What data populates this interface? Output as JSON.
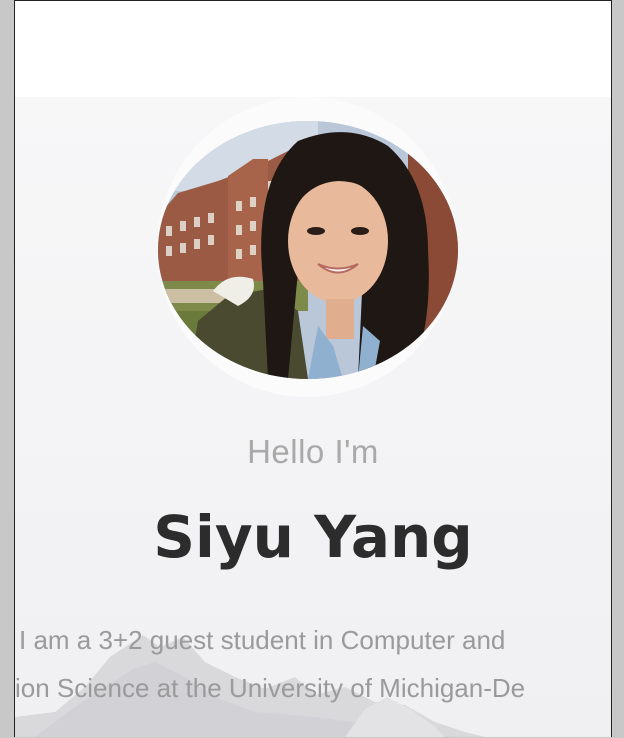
{
  "hero": {
    "greeting": "Hello I'm",
    "name": "Siyu Yang",
    "bio_line_1": "I am a 3+2 guest student in Computer and",
    "bio_line_2": "ion Science at the University of Michigan-De"
  },
  "colors": {
    "name": "#2c2c2c",
    "greeting": "#a9a9a9",
    "bio": "#9a9a9a",
    "background": "#f3f3f5"
  },
  "avatar": {
    "icon": "profile-photo"
  }
}
